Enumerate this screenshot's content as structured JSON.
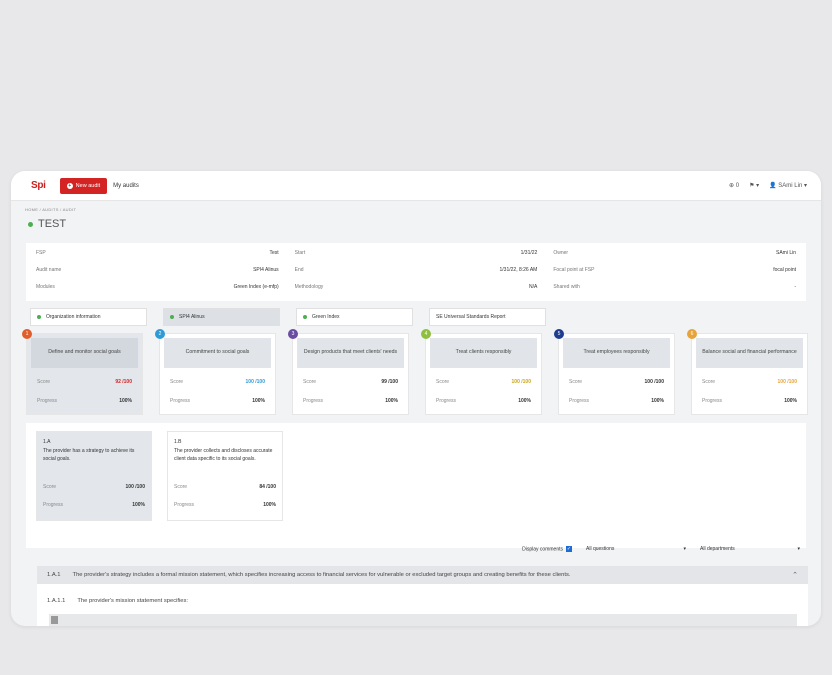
{
  "app": {
    "logo": "Spi",
    "new_audit": "New audit",
    "my_audits": "My audits"
  },
  "topbar_right": {
    "counter": "0",
    "flag": "▾",
    "user": "SAmi Lin"
  },
  "breadcrumb": "HOME / AUDITS / AUDIT",
  "page_title": "TEST",
  "info": {
    "col1": [
      {
        "label": "FSP",
        "value": "Test"
      },
      {
        "label": "Audit name",
        "value": "SPI4 Alinus"
      },
      {
        "label": "Modules",
        "value": "Green Index (e-mfp)"
      }
    ],
    "col2": [
      {
        "label": "Start",
        "value": "1/31/22"
      },
      {
        "label": "End",
        "value": "1/31/22, 8:26 AM"
      },
      {
        "label": "Methodology",
        "value": "N/A"
      }
    ],
    "col3": [
      {
        "label": "Owner",
        "value": "SAmi Lin"
      },
      {
        "label": "Focal point at FSP",
        "value": "focal point"
      },
      {
        "label": "Shared with",
        "value": "-"
      }
    ]
  },
  "tabs": [
    {
      "label": "Organization information"
    },
    {
      "label": "SPI4 Alinus"
    },
    {
      "label": "Green Index"
    },
    {
      "label": "SE Universal Standards Report"
    }
  ],
  "goals": [
    {
      "num": "1",
      "color": "#e05d2c",
      "title": "Define and monitor social goals",
      "score": "92 /100",
      "score_color": "#d42323",
      "progress": "100%"
    },
    {
      "num": "2",
      "color": "#2e9bd6",
      "title": "Commitment to social goals",
      "score": "100 /100",
      "score_color": "#2e9bd6",
      "progress": "100%"
    },
    {
      "num": "3",
      "color": "#6a4ca3",
      "title": "Design products that meet clients' needs",
      "score": "99 /100",
      "score_color": "#333333",
      "progress": "100%"
    },
    {
      "num": "4",
      "color": "#8fbf3f",
      "title": "Treat clients responsibly",
      "score": "100 /100",
      "score_color": "#c9a51a",
      "progress": "100%"
    },
    {
      "num": "5",
      "color": "#1f3d8f",
      "title": "Treat employees responsibly",
      "score": "100 /100",
      "score_color": "#333333",
      "progress": "100%"
    },
    {
      "num": "6",
      "color": "#e8a33a",
      "title": "Balance social and financial performance",
      "score": "100 /100",
      "score_color": "#e8a33a",
      "progress": "100%"
    }
  ],
  "goal_labels": {
    "score": "Score",
    "progress": "Progress"
  },
  "subs": [
    {
      "code": "1.A",
      "desc": "The provider has a strategy to achieve its social goals.",
      "score": "100 /100",
      "progress": "100%"
    },
    {
      "code": "1.B",
      "desc": "The provider collects and discloses accurate client data specific to its social goals.",
      "score": "84 /100",
      "progress": "100%"
    }
  ],
  "filters": {
    "display_comments": "Display comments",
    "questions": "All questions",
    "departments": "All departments"
  },
  "question": {
    "code": "1.A.1",
    "text": "The provider's strategy includes a formal mission statement, which specifies increasing access to financial services for vulnerable or excluded target groups and creating benefits for these clients."
  },
  "sub_question": {
    "code": "1.A.1.1",
    "text": "The provider's mission statement specifies:"
  }
}
